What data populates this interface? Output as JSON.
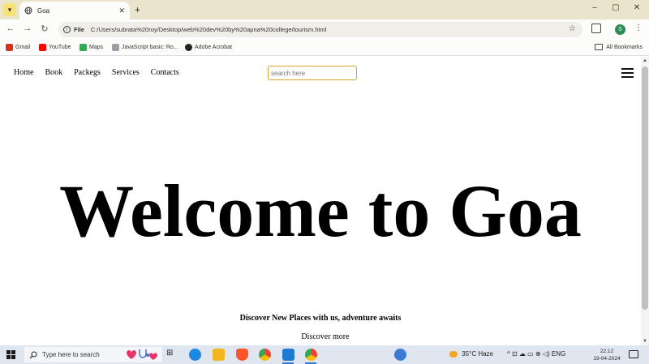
{
  "browser": {
    "tab_title": "Goa",
    "tab_close": "✕",
    "new_tab": "+",
    "window_controls": [
      "–",
      "▢",
      "✕"
    ],
    "nav": {
      "back": "←",
      "forward": "→",
      "reload": "↻"
    },
    "address": {
      "scheme": "File",
      "url": "C:/Users/subrata%20roy/Desktop/web%20dev%20by%20apna%20college/tourism.html",
      "star": "☆"
    },
    "profile_initial": "S",
    "menu_icon": "⋮",
    "bookmarks": [
      {
        "label": "Gmail",
        "color": "#d93025"
      },
      {
        "label": "YouTube",
        "color": "#ff0000"
      },
      {
        "label": "Maps",
        "color": "#34a853"
      },
      {
        "label": "JavaScript basic: Ro...",
        "color": "#9aa0a6"
      },
      {
        "label": "Adobe Acrobat",
        "color": "#222222"
      }
    ],
    "all_bookmarks": "All Bookmarks"
  },
  "page": {
    "nav_links": [
      "Home",
      "Book",
      "Packegs",
      "Services",
      "Contacts"
    ],
    "search_placeholder": "search here",
    "hero_title": "Welcome to Goa",
    "tagline": "Discover New Places with us, adventure awaits",
    "discover_link": "Discover more"
  },
  "taskbar": {
    "search_placeholder": "Type here to search",
    "weather": "35°C  Haze",
    "tray_icons_text": "^  ⊡  ☁  ▭  ⊕  ◁)  ENG",
    "time": "22:12",
    "date": "19-04-2024"
  },
  "colors": {
    "tabstrip_bg": "#e9e4ca",
    "search_border": "#d9a52e",
    "taskbar_bg": "#dfe6ef"
  }
}
